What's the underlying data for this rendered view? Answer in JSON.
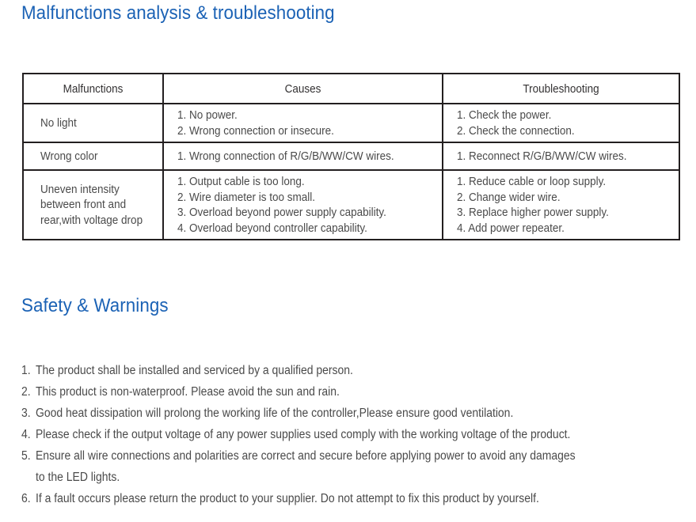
{
  "page": {
    "accent_color": "#1b62b5",
    "text_color": "#4a4a4a",
    "border_color": "#231f20",
    "background": "#ffffff"
  },
  "sections": {
    "malfunctions": {
      "title": "Malfunctions analysis & troubleshooting"
    },
    "safety": {
      "title": "Safety & Warnings"
    }
  },
  "table": {
    "headers": {
      "malfunctions": "Malfunctions",
      "causes": "Causes",
      "troubleshooting": "Troubleshooting"
    },
    "rows": [
      {
        "malfunction": "No light",
        "malfunction_lines": [
          "No light"
        ],
        "causes": [
          "1. No power.",
          "2. Wrong connection or insecure."
        ],
        "troubleshooting": [
          "1. Check the power.",
          "2. Check the connection."
        ]
      },
      {
        "malfunction": "Wrong color",
        "malfunction_lines": [
          "Wrong color"
        ],
        "causes": [
          "1. Wrong connection of R/G/B/WW/CW wires."
        ],
        "troubleshooting": [
          "1. Reconnect R/G/B/WW/CW wires."
        ]
      },
      {
        "malfunction": "Uneven intensity between front and rear,with voltage drop",
        "malfunction_lines": [
          "Uneven intensity",
          "between front and",
          "rear,with voltage drop"
        ],
        "causes": [
          "1. Output cable is too long.",
          "2. Wire diameter is too small.",
          "3. Overload beyond power supply capability.",
          "4. Overload beyond controller capability."
        ],
        "troubleshooting": [
          "1. Reduce cable or loop supply.",
          "2. Change wider wire.",
          "3. Replace higher power supply.",
          "4. Add power repeater."
        ]
      }
    ]
  },
  "safety_list": [
    {
      "number": "1.",
      "text": "The product shall be installed and serviced by a qualified person.",
      "continuation": ""
    },
    {
      "number": "2.",
      "text": "This product is non-waterproof. Please avoid the sun and rain.",
      "continuation": ""
    },
    {
      "number": "3.",
      "text": "Good heat dissipation will prolong the working life of the controller,Please ensure good ventilation.",
      "continuation": ""
    },
    {
      "number": "4.",
      "text": "Please check if the output voltage of any power supplies used comply with the working voltage of the product.",
      "continuation": ""
    },
    {
      "number": "5.",
      "text": "Ensure all wire connections and polarities are correct and secure before applying power to avoid any damages",
      "continuation": "to the LED lights."
    },
    {
      "number": "6.",
      "text": "If a fault occurs please return the product to your supplier. Do not attempt to fix this product by yourself.",
      "continuation": ""
    }
  ]
}
